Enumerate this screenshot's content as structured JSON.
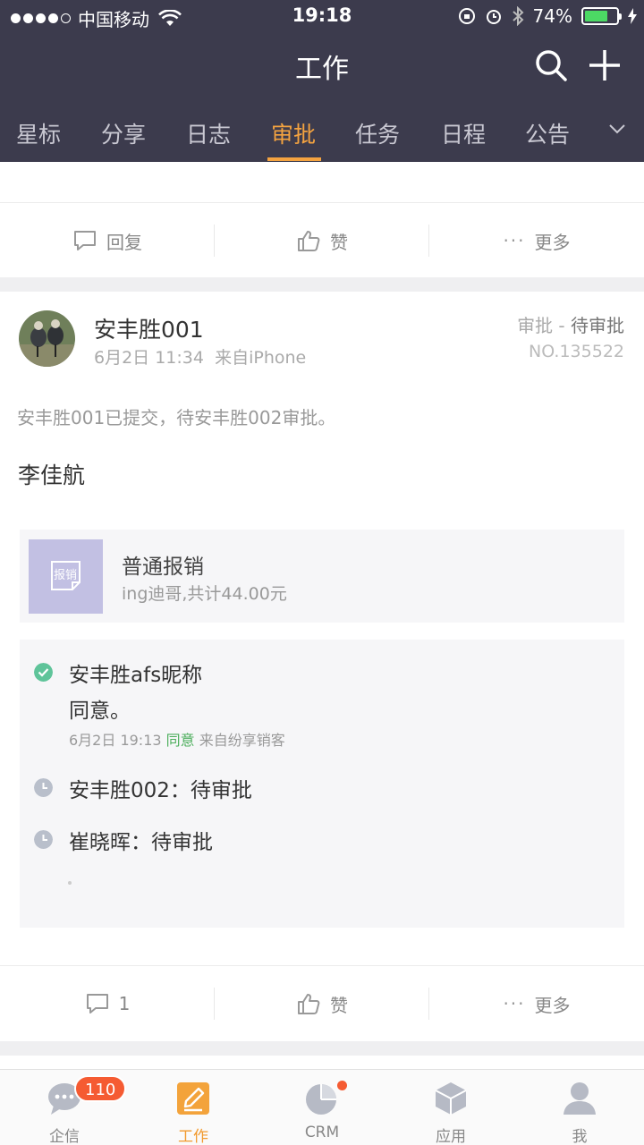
{
  "status_bar": {
    "carrier": "中国移动",
    "time": "19:18",
    "battery": "74%",
    "battery_level": 0.74
  },
  "header": {
    "title": "工作",
    "tabs": [
      {
        "label": "星标"
      },
      {
        "label": "分享"
      },
      {
        "label": "日志"
      },
      {
        "label": "审批"
      },
      {
        "label": "任务"
      },
      {
        "label": "日程"
      },
      {
        "label": "公告"
      }
    ],
    "active_tab": "审批"
  },
  "top_actions": {
    "reply": "回复",
    "like": "赞",
    "more": "更多"
  },
  "post": {
    "author": "安丰胜001",
    "date": "6月2日 11:34",
    "source": "来自iPhone",
    "type": "审批",
    "separator": "-",
    "status": "待审批",
    "serial": "NO.135522",
    "summary": "安丰胜001已提交，待安丰胜002审批。",
    "person": "李佳航",
    "attachment": {
      "thumb_label": "报销",
      "title": "普通报销",
      "subtitle": "ing迪哥,共计44.00元"
    },
    "flow": {
      "approved": {
        "name": "安丰胜afs昵称",
        "comment": "同意。",
        "date": "6月2日 19:13",
        "result": "同意",
        "source": "来自纷享销客"
      },
      "pending": [
        {
          "text": "安丰胜002：待审批"
        },
        {
          "text": "崔晓晖：待审批"
        }
      ]
    },
    "actions": {
      "reply_count": "1",
      "like": "赞",
      "more": "更多"
    }
  },
  "bottom_nav": [
    {
      "label": "企信",
      "badge": "110"
    },
    {
      "label": "工作"
    },
    {
      "label": "CRM"
    },
    {
      "label": "应用"
    },
    {
      "label": "我"
    }
  ],
  "colors": {
    "header_bg": "#3c3b4d",
    "accent": "#f4a340",
    "badge": "#f55b32",
    "approved": "#4cae5c"
  }
}
